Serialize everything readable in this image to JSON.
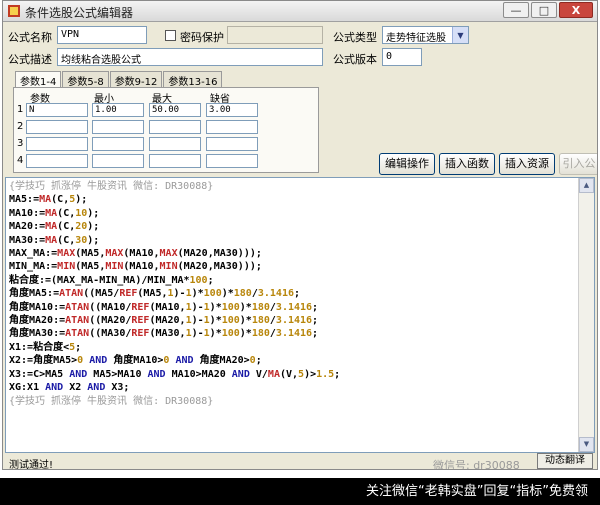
{
  "window": {
    "title": "条件选股公式编辑器",
    "min": "—",
    "max": "□",
    "close": "X"
  },
  "form": {
    "name_label": "公式名称",
    "name_value": "VPN",
    "password_label": "密码保护",
    "type_label": "公式类型",
    "type_value": "走势特征选股",
    "desc_label": "公式描述",
    "desc_value": "均线粘合选股公式",
    "version_label": "公式版本",
    "version_value": "0"
  },
  "tabs": [
    "参数1-4",
    "参数5-8",
    "参数9-12",
    "参数13-16"
  ],
  "params": {
    "headers": [
      "参数",
      "最小",
      "最大",
      "缺省"
    ],
    "rows": [
      {
        "num": "1",
        "name": "N",
        "min": "1.00",
        "max": "50.00",
        "def": "3.00"
      },
      {
        "num": "2",
        "name": "",
        "min": "",
        "max": "",
        "def": ""
      },
      {
        "num": "3",
        "name": "",
        "min": "",
        "max": "",
        "def": ""
      },
      {
        "num": "4",
        "name": "",
        "min": "",
        "max": "",
        "def": ""
      }
    ]
  },
  "buttons": {
    "edit": "编辑操作",
    "insert_fn": "插入函数",
    "insert_res": "插入资源",
    "import": "引入公"
  },
  "code": {
    "comment": "{学技巧 抓涨停 牛股资讯 微信: DR30088}",
    "l01": "MA5:=",
    "l01f": "MA",
    "l01a": "(C,",
    "l01n": "5",
    "l01b": ");",
    "l02": "MA10:=",
    "l02f": "MA",
    "l02a": "(C,",
    "l02n": "10",
    "l02b": ");",
    "l03": "MA20:=",
    "l03f": "MA",
    "l03a": "(C,",
    "l03n": "20",
    "l03b": ");",
    "l04": "MA30:=",
    "l04f": "MA",
    "l04a": "(C,",
    "l04n": "30",
    "l04b": ");",
    "l05a": "MAX_MA:=",
    "l05f1": "MAX",
    "l05b": "(MA5,",
    "l05f2": "MAX",
    "l05c": "(MA10,",
    "l05f3": "MAX",
    "l05d": "(MA20,MA30)));",
    "l06a": "MIN_MA:=",
    "l06f1": "MIN",
    "l06b": "(MA5,",
    "l06f2": "MIN",
    "l06c": "(MA10,",
    "l06f3": "MIN",
    "l06d": "(MA20,MA30)));",
    "l07a": "粘合度:=(MAX_MA-MIN_MA)/MIN_MA*",
    "l07n": "100",
    "l07b": ";",
    "l08a": "角度MA5:=",
    "l08f1": "ATAN",
    "l08b": "((MA5/",
    "l08f2": "REF",
    "l08c": "(MA5,",
    "l08n1": "1",
    "l08d": ")-",
    "l08n2": "1",
    "l08e": ")*",
    "l08n3": "100",
    "l08g": ")*",
    "l08n4": "180",
    "l08h": "/",
    "l08n5": "3.1416",
    "l08i": ";",
    "l09a": "角度MA10:=",
    "l09f1": "ATAN",
    "l09b": "((MA10/",
    "l09f2": "REF",
    "l09c": "(MA10,",
    "l09n1": "1",
    "l09d": ")-",
    "l09n2": "1",
    "l09e": ")*",
    "l09n3": "100",
    "l09g": ")*",
    "l09n4": "180",
    "l09h": "/",
    "l09n5": "3.1416",
    "l09i": ";",
    "l10a": "角度MA20:=",
    "l10f1": "ATAN",
    "l10b": "((MA20/",
    "l10f2": "REF",
    "l10c": "(MA20,",
    "l10n1": "1",
    "l10d": ")-",
    "l10n2": "1",
    "l10e": ")*",
    "l10n3": "100",
    "l10g": ")*",
    "l10n4": "180",
    "l10h": "/",
    "l10n5": "3.1416",
    "l10i": ";",
    "l11a": "角度MA30:=",
    "l11f1": "ATAN",
    "l11b": "((MA30/",
    "l11f2": "REF",
    "l11c": "(MA30,",
    "l11n1": "1",
    "l11d": ")-",
    "l11n2": "1",
    "l11e": ")*",
    "l11n3": "100",
    "l11g": ")*",
    "l11n4": "180",
    "l11h": "/",
    "l11n5": "3.1416",
    "l11i": ";",
    "l12a": "X1:=粘合度<",
    "l12n": "5",
    "l12b": ";",
    "l13a": "X2:=角度MA5>",
    "l13n1": "0",
    "l13k1": " AND ",
    "l13b": "角度MA10>",
    "l13n2": "0",
    "l13k2": " AND ",
    "l13c": "角度MA20>",
    "l13n3": "0",
    "l13d": ";",
    "l14a": "X3:=C>MA5",
    "l14k1": " AND ",
    "l14b": "MA5>MA10",
    "l14k2": " AND ",
    "l14c": "MA10>MA20",
    "l14k3": " AND ",
    "l14d": "V/",
    "l14f": "MA",
    "l14e": "(V,",
    "l14n1": "5",
    "l14g": ")>",
    "l14n2": "1.5",
    "l14h": ";",
    "l15a": "XG:X1",
    "l15k1": " AND ",
    "l15b": "X2",
    "l15k2": " AND ",
    "l15c": "X3;",
    "comment2": "{学技巧 抓涨停 牛股资讯 微信: DR30088}"
  },
  "status": {
    "text": "测试通过!",
    "test_button": "动态翻译",
    "watermark": "微信号: dr30088"
  },
  "bottom_banner": "关注微信“老韩实盘”回复“指标”免费领"
}
